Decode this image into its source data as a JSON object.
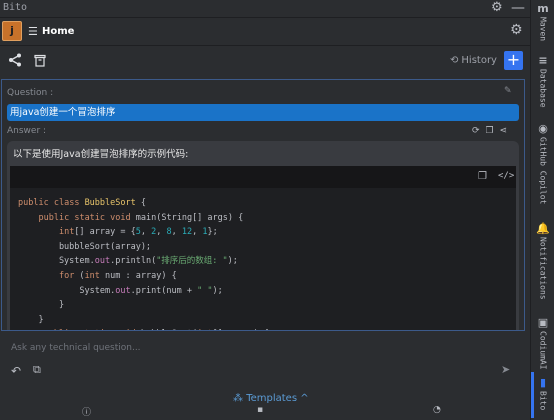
{
  "window": {
    "title": "Bito"
  },
  "tab": {
    "avatar_letter": "j",
    "label": "Home"
  },
  "toolbar": {
    "history_label": "History",
    "new_label": "+"
  },
  "question": {
    "label": "Question :",
    "text": "用java创建一个冒泡排序"
  },
  "answer": {
    "label": "Answer :",
    "intro": "以下是使用Java创建冒泡排序的示例代码:"
  },
  "code_lines": [
    "public class BubbleSort {",
    "    public static void main(String[] args) {",
    "        int[] array = {5, 2, 8, 12, 1};",
    "        bubbleSort(array);",
    "        System.out.println(\"排序后的数组: \");",
    "        for (int num : array) {",
    "            System.out.print(num + \" \");",
    "        }",
    "    }",
    "     public static void bubbleSort(int[] array) {"
  ],
  "input": {
    "placeholder": "Ask any technical question..."
  },
  "templates": {
    "label": "Templates ^"
  },
  "sidebar": {
    "items": [
      {
        "label": "Maven",
        "icon": "m"
      },
      {
        "label": "Database",
        "icon": "≡"
      },
      {
        "label": "GitHub Copilot",
        "icon": "◉"
      },
      {
        "label": "Notifications",
        "icon": "🔔"
      },
      {
        "label": "CodiumAI",
        "icon": "▣"
      },
      {
        "label": "Bito",
        "icon": "▮"
      }
    ]
  },
  "colors": {
    "accent": "#3574f0",
    "question_bg": "#1a73c8",
    "answer_bg": "#393b40",
    "code_bg": "#1e1f22"
  }
}
